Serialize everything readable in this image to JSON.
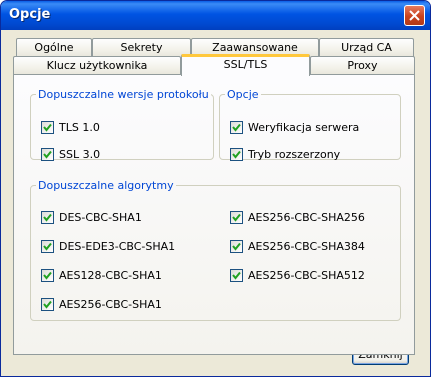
{
  "window": {
    "title": "Opcje"
  },
  "tabs_back": [
    "Ogólne",
    "Sekrety",
    "Zaawansowane",
    "Urząd CA"
  ],
  "tabs_front": [
    "Klucz użytkownika",
    "SSL/TLS",
    "Proxy"
  ],
  "protocols": {
    "legend": "Dopuszczalne wersje protokołu",
    "items": [
      {
        "label": "TLS 1.0",
        "checked": true
      },
      {
        "label": "SSL 3.0",
        "checked": true
      }
    ]
  },
  "options": {
    "legend": "Opcje",
    "items": [
      {
        "label": "Weryfikacja serwera",
        "checked": true
      },
      {
        "label": "Tryb rozszerzony",
        "checked": true
      }
    ]
  },
  "algorithms": {
    "legend": "Dopuszczalne algorytmy",
    "left": [
      {
        "label": "DES-CBC-SHA1",
        "checked": true
      },
      {
        "label": "DES-EDE3-CBC-SHA1",
        "checked": true
      },
      {
        "label": "AES128-CBC-SHA1",
        "checked": true
      },
      {
        "label": "AES256-CBC-SHA1",
        "checked": true
      }
    ],
    "right": [
      {
        "label": "AES256-CBC-SHA256",
        "checked": true
      },
      {
        "label": "AES256-CBC-SHA384",
        "checked": true
      },
      {
        "label": "AES256-CBC-SHA512",
        "checked": true
      }
    ]
  },
  "close_button": "Zamknij",
  "colors": {
    "legend": "#0046d5",
    "active_tab_accent": "#ffc83c",
    "title_bar": "#0054e3"
  }
}
